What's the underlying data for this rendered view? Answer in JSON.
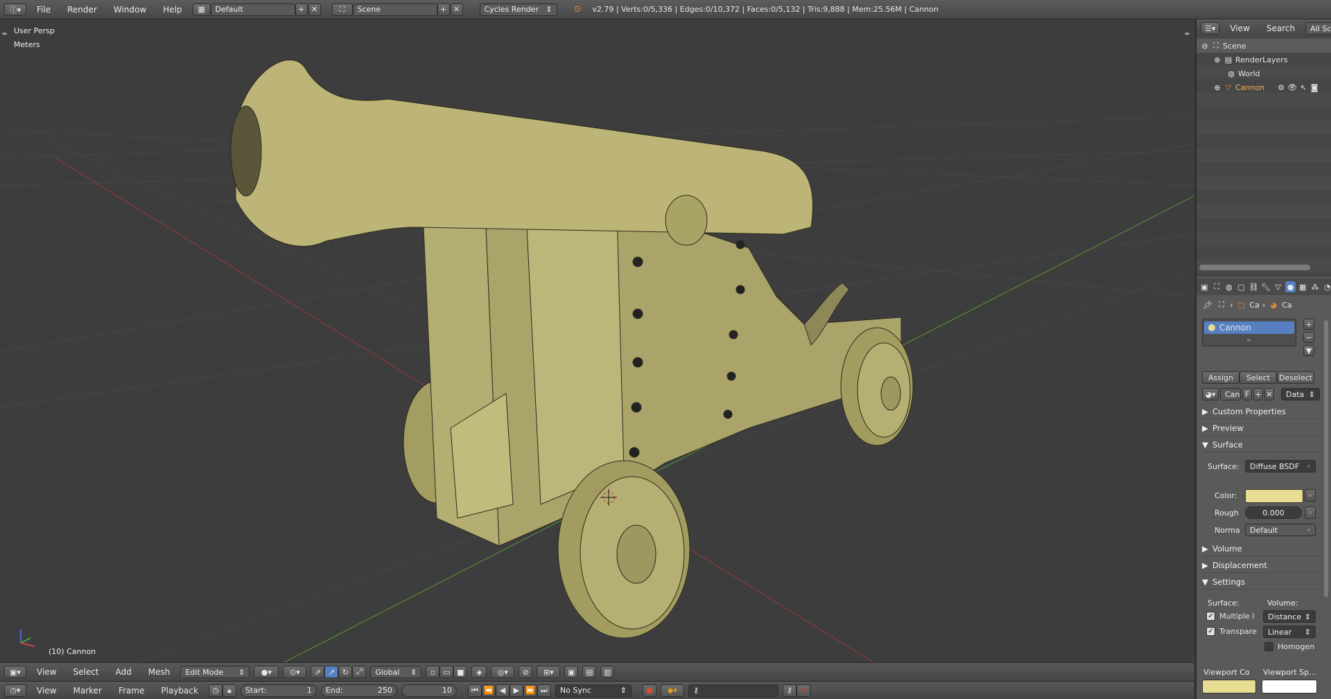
{
  "topbar": {
    "menus": [
      "File",
      "Render",
      "Window",
      "Help"
    ],
    "screen_layout": "Default",
    "scene": "Scene",
    "render_engine": "Cycles Render",
    "stats": "v2.79 | Verts:0/5,336 | Edges:0/10,372 | Faces:0/5,132 | Tris:9,888 | Mem:25.56M | Cannon"
  },
  "viewport": {
    "view_name": "User Persp",
    "units": "Meters",
    "object_label": "(10) Cannon",
    "colors": {
      "mesh": "#b2ab70",
      "background": "#3d3d3d",
      "x_axis": "#8a3a3a",
      "y_axis": "#4e8a3a"
    }
  },
  "view3d_header": {
    "menus": [
      "View",
      "Select",
      "Add",
      "Mesh"
    ],
    "mode": "Edit Mode",
    "orientation": "Global"
  },
  "timeline": {
    "menus": [
      "View",
      "Marker",
      "Frame",
      "Playback"
    ],
    "start_label": "Start:",
    "start": "1",
    "end_label": "End:",
    "end": "250",
    "current": "10",
    "sync": "No Sync"
  },
  "outliner": {
    "menus": [
      "View",
      "Search"
    ],
    "filter": "All Scenes",
    "items": [
      {
        "label": "Scene"
      },
      {
        "label": "RenderLayers"
      },
      {
        "label": "World"
      },
      {
        "label": "Cannon"
      }
    ]
  },
  "properties": {
    "breadcrumb": [
      "Ca",
      "Ca"
    ],
    "material_slot": "Cannon",
    "assign": "Assign",
    "select": "Select",
    "deselect": "Deselect",
    "material_name": "Can",
    "fake_user": "F",
    "link": "Data",
    "panels": {
      "custom_properties": "Custom Properties",
      "preview": "Preview",
      "surface": "Surface",
      "volume": "Volume",
      "displacement": "Displacement",
      "settings": "Settings"
    },
    "surface": {
      "surface_label": "Surface:",
      "surface_value": "Diffuse BSDF",
      "color_label": "Color:",
      "color_value": "#e8de93",
      "rough_label": "Rough",
      "rough_value": "0.000",
      "normal_label": "Norma",
      "normal_value": "Default"
    },
    "settings": {
      "surface_label": "Surface:",
      "volume_label": "Volume:",
      "multiple_importance": "Multiple I",
      "transparent_shadows": "Transpare",
      "volume_sampling": "Distance",
      "volume_interpolation": "Linear",
      "homogeneous": "Homogen"
    },
    "viewport_color_label": "Viewport Co",
    "viewport_specular_label": "Viewport Sp..."
  }
}
